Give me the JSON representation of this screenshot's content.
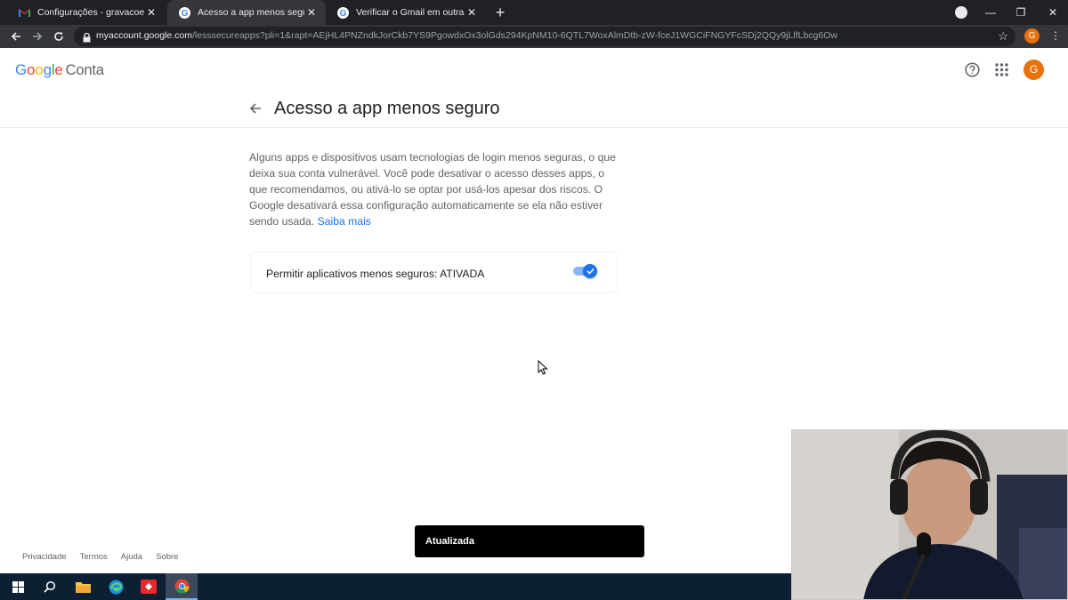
{
  "browser": {
    "tabs": [
      {
        "title": "Configurações - gravacoesphsbr",
        "favicon": "gmail-icon",
        "active": false
      },
      {
        "title": "Acesso a app menos seguro",
        "favicon": "google-icon",
        "active": true
      },
      {
        "title": "Verificar o Gmail em outras plata",
        "favicon": "google-icon",
        "active": false
      }
    ],
    "new_tab": "+",
    "url_host": "myaccount.google.com",
    "url_path": "/lesssecureapps?pli=1&rapt=AEjHL4PNZndkJorCkb7YS9PgowdxOx3olGds294KpNM10-6QTL7WoxAlmDtb-zW-fceJ1WGCiFNGYFcSDj2QQy9jLlfLbcg6Ow",
    "profile_initial": "G",
    "accent": "#e8710a"
  },
  "header": {
    "logo_letters": [
      "G",
      "o",
      "o",
      "g",
      "l",
      "e"
    ],
    "logo_colors": [
      "#4285f4",
      "#ea4335",
      "#fbbc05",
      "#4285f4",
      "#34a853",
      "#ea4335"
    ],
    "product": "Conta",
    "avatar_initial": "G"
  },
  "page": {
    "title": "Acesso a app menos seguro",
    "description": "Alguns apps e dispositivos usam tecnologias de login menos seguras, o que deixa sua conta vulnerável. Você pode desativar o acesso desses apps, o que recomendamos, ou ativá-lo se optar por usá-los apesar dos riscos. O Google desativará essa configuração automaticamente se ela não estiver sendo usada.",
    "learn_more": "Saiba mais",
    "setting_label": "Permitir aplicativos menos seguros: ATIVADA",
    "setting_on": true
  },
  "footer": {
    "links": [
      "Privacidade",
      "Termos",
      "Ajuda",
      "Sobre"
    ]
  },
  "snackbar": {
    "text": "Atualizada"
  },
  "taskbar": {
    "items": [
      "windows-start-icon",
      "search-icon",
      "file-explorer-icon",
      "edge-icon",
      "anydesk-icon",
      "chrome-icon"
    ]
  }
}
